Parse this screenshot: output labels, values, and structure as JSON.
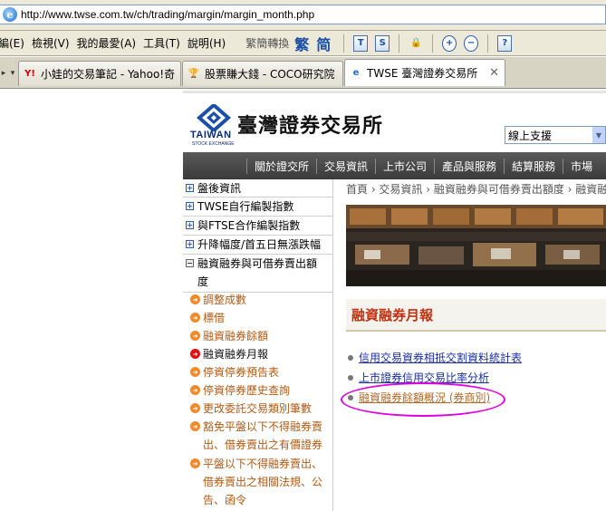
{
  "browser": {
    "url": "http://www.twse.com.tw/ch/trading/margin/margin_month.php",
    "menu": [
      "編(E)",
      "檢視(V)",
      "我的最愛(A)",
      "工具(T)",
      "說明(H)"
    ],
    "toolbar_label": "繁簡轉換",
    "toolbar_trad": "繁",
    "toolbar_simp": "简",
    "tabs": [
      {
        "label": "小娃的交易筆記 - Yahoo!奇..."
      },
      {
        "label": "股票賺大錢 - COCO研究院"
      },
      {
        "label": "TWSE 臺灣證券交易所 ..."
      }
    ]
  },
  "header": {
    "logo_en": "TAIWAN",
    "logo_en2": "STOCK EXCHANGE",
    "logo_cjk": "臺灣證券交易所",
    "support_select": "線上支援"
  },
  "nav": [
    "關於證交所",
    "交易資訊",
    "上市公司",
    "產品與服務",
    "結算服務",
    "市場"
  ],
  "sidebar": {
    "items": [
      {
        "label": "盤後資訊"
      },
      {
        "label": "TWSE自行編製指數"
      },
      {
        "label": "與FTSE合作編製指數"
      },
      {
        "label": "升降幅度/首五日無漲跌幅"
      },
      {
        "label": "融資融券與可借券賣出額",
        "label2": "度"
      }
    ],
    "sub_items": [
      {
        "label": "調整成數"
      },
      {
        "label": "標借"
      },
      {
        "label": "融資融券餘額"
      },
      {
        "label": "融資融券月報"
      },
      {
        "label": "停資停券預告表"
      },
      {
        "label": "停資停券歷史查詢"
      },
      {
        "label": "更改委託交易類別筆數"
      },
      {
        "label": "豁免平盤以下不得融券賣",
        "label2": "出、借券賣出之有價證券"
      },
      {
        "label": "平盤以下不得融券賣出、",
        "label2": "借券賣出之相關法規、公",
        "label3": "告、函令"
      }
    ]
  },
  "main": {
    "breadcrumb": "首頁 › 交易資訊 › 融資融券與可借券賣出額度 › 融資融券月報",
    "section_title": "融資融券月報",
    "links": [
      {
        "label": "信用交易資券相抵交割資料統計表"
      },
      {
        "label": "上市證券信用交易比率分析"
      },
      {
        "label": "融資融券餘額概況 (券商別)"
      }
    ]
  },
  "colors": {
    "highlight_ellipse": "#e000e0",
    "section_title": "#c03010",
    "link": "#1a2fa0",
    "sub_link": "#b05a14"
  }
}
